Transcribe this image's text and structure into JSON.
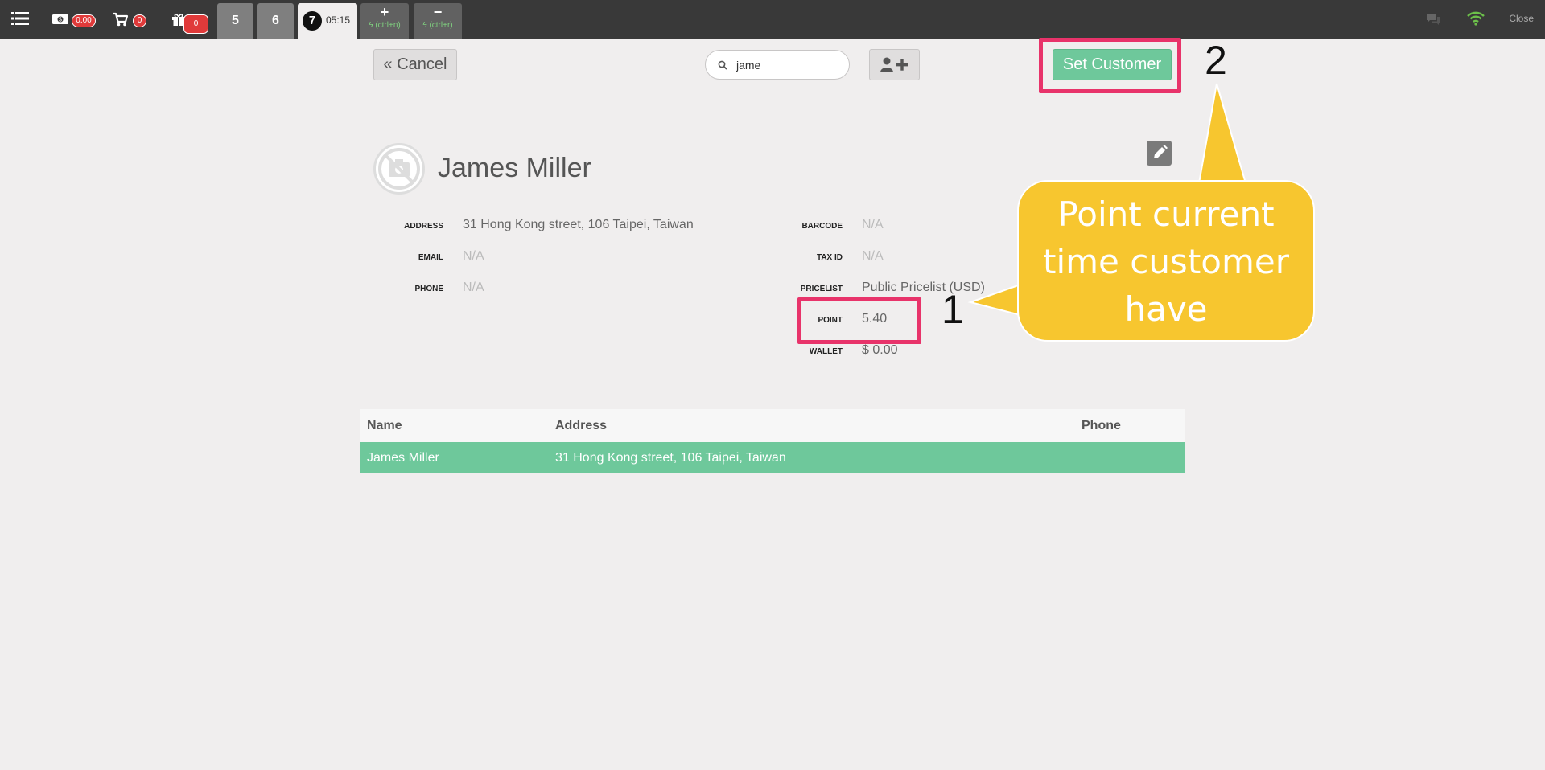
{
  "topbar": {
    "cash_badge": "0.00",
    "cart_badge": "0",
    "gift_badge": "0",
    "order_tabs": [
      {
        "label": "5"
      },
      {
        "label": "6"
      }
    ],
    "active_order": {
      "number": "7",
      "time": "05:15"
    },
    "add_order": {
      "symbol": "+",
      "hint": "(ctrl+n)"
    },
    "remove_order": {
      "symbol": "−",
      "hint": "(ctrl+r)"
    },
    "close_label": "Close",
    "colors": {
      "bar": "#393939",
      "wifi": "#6cc04a",
      "badge": "#e03a3a"
    }
  },
  "toolbar": {
    "cancel_label": "Cancel",
    "search_value": "jame",
    "set_customer_label": "Set Customer"
  },
  "customer": {
    "name": "James Miller",
    "left_fields": [
      {
        "label": "ADDRESS",
        "value": "31 Hong Kong street, 106 Taipei, Taiwan"
      },
      {
        "label": "EMAIL",
        "value": "N/A"
      },
      {
        "label": "PHONE",
        "value": "N/A"
      }
    ],
    "right_fields": [
      {
        "label": "BARCODE",
        "value": "N/A"
      },
      {
        "label": "TAX ID",
        "value": "N/A"
      },
      {
        "label": "PRICELIST",
        "value": "Public Pricelist (USD)"
      },
      {
        "label": "POINT",
        "value": "5.40"
      },
      {
        "label": "WALLET",
        "value": "$ 0.00"
      }
    ]
  },
  "annotations": {
    "marker_1": "1",
    "marker_2": "2",
    "callout_lines": [
      "Point current",
      "time customer",
      "have"
    ],
    "highlight_color": "#e8336a",
    "callout_color": "#f7c62f"
  },
  "table": {
    "headers": [
      "Name",
      "Address",
      "Phone"
    ],
    "rows": [
      [
        "James Miller",
        "31 Hong Kong street, 106 Taipei, Taiwan",
        ""
      ]
    ],
    "selected_color": "#6ec89b"
  }
}
